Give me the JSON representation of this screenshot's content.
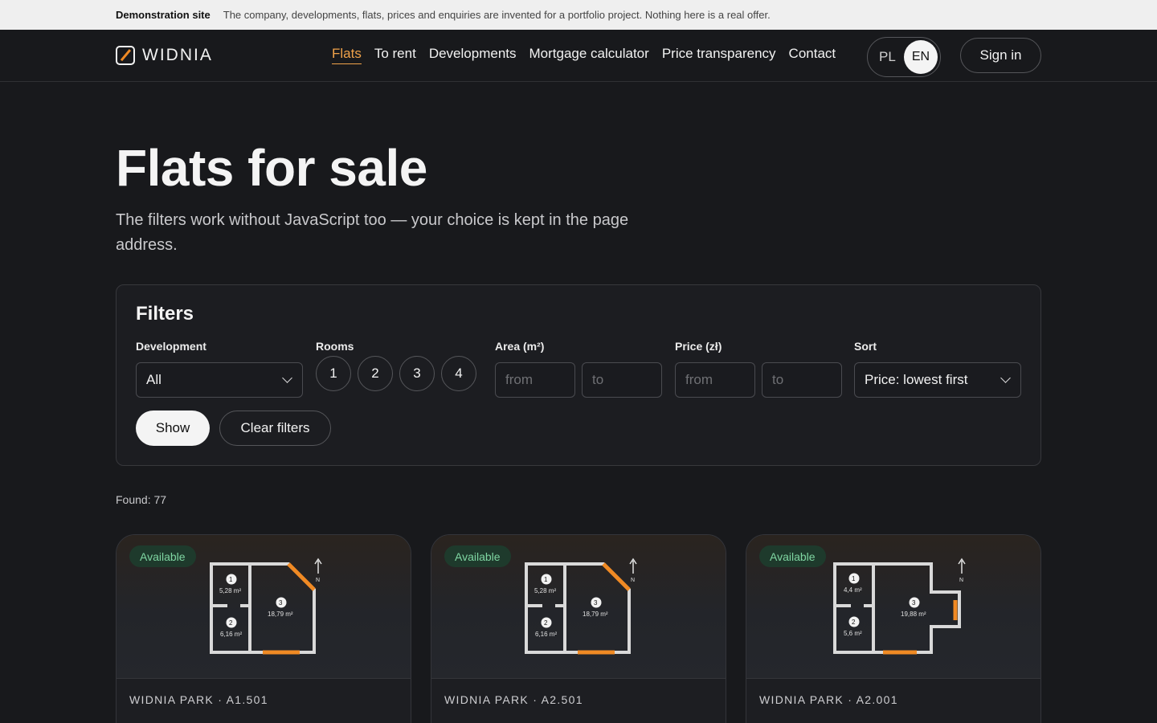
{
  "demo_banner": {
    "title": "Demonstration site",
    "text": "The company, developments, flats, prices and enquiries are invented for a portfolio project. Nothing here is a real offer."
  },
  "header": {
    "logo_text": "WIDNIA",
    "nav": [
      "Flats",
      "To rent",
      "Developments",
      "Mortgage calculator",
      "Price transparency",
      "Contact"
    ],
    "active_nav": "Flats",
    "lang_options": [
      "PL",
      "EN"
    ],
    "active_lang": "EN",
    "sign_in": "Sign in"
  },
  "hero": {
    "title": "Flats for sale",
    "subtitle": "The filters work without JavaScript too — your choice is kept in the page address."
  },
  "filters": {
    "title": "Filters",
    "development_label": "Development",
    "development_value": "All",
    "rooms_label": "Rooms",
    "rooms": [
      "1",
      "2",
      "3",
      "4"
    ],
    "area_label": "Area (m²)",
    "price_label": "Price (zł)",
    "from_placeholder": "from",
    "to_placeholder": "to",
    "sort_label": "Sort",
    "sort_value": "Price: lowest first",
    "show_button": "Show",
    "clear_button": "Clear filters"
  },
  "results": {
    "found": "Found: 77"
  },
  "cards": [
    {
      "status": "Available",
      "title": "WIDNIA PARK · A1.501",
      "plan": {
        "rooms": [
          {
            "n": "1",
            "area": "5,28 m²"
          },
          {
            "n": "2",
            "area": "6,16 m²"
          },
          {
            "n": "3",
            "area": "18,79 m²"
          }
        ],
        "compass": "N"
      }
    },
    {
      "status": "Available",
      "title": "WIDNIA PARK · A2.501",
      "plan": {
        "rooms": [
          {
            "n": "1",
            "area": "5,28 m²"
          },
          {
            "n": "2",
            "area": "6,16 m²"
          },
          {
            "n": "3",
            "area": "18,79 m²"
          }
        ],
        "compass": "N"
      }
    },
    {
      "status": "Available",
      "title": "WIDNIA PARK · A2.001",
      "plan": {
        "rooms": [
          {
            "n": "1",
            "area": "4,4 m²"
          },
          {
            "n": "2",
            "area": "5,6 m²"
          },
          {
            "n": "3",
            "area": "19,88 m²"
          }
        ],
        "compass": "N"
      }
    }
  ],
  "colors": {
    "background": "#18191c",
    "accent": "#f0a24a",
    "available_badge": "#7fd6a2"
  }
}
